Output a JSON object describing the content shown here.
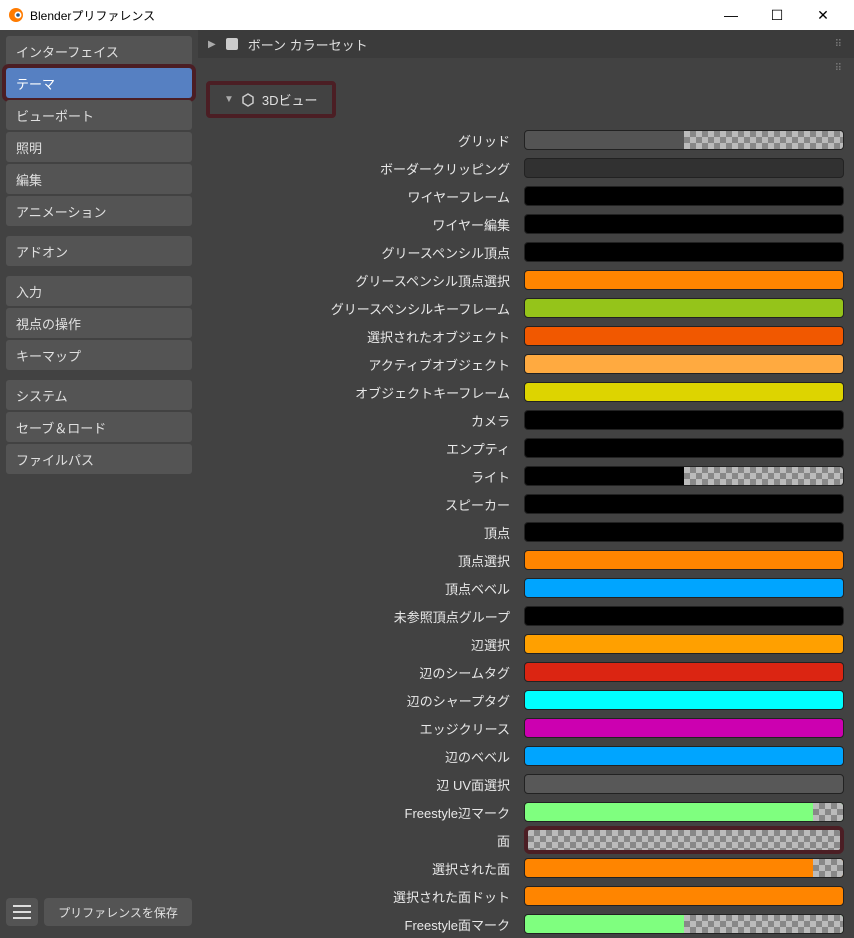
{
  "window": {
    "title": "Blenderプリファレンス"
  },
  "sidebar": {
    "groups": [
      {
        "items": [
          {
            "label": "インターフェイス",
            "selected": false
          },
          {
            "label": "テーマ",
            "selected": true,
            "highlighted": true
          },
          {
            "label": "ビューポート",
            "selected": false
          },
          {
            "label": "照明",
            "selected": false
          },
          {
            "label": "編集",
            "selected": false
          },
          {
            "label": "アニメーション",
            "selected": false
          }
        ]
      },
      {
        "items": [
          {
            "label": "アドオン",
            "selected": false
          }
        ]
      },
      {
        "items": [
          {
            "label": "入力",
            "selected": false
          },
          {
            "label": "視点の操作",
            "selected": false
          },
          {
            "label": "キーマップ",
            "selected": false
          }
        ]
      },
      {
        "items": [
          {
            "label": "システム",
            "selected": false
          },
          {
            "label": "セーブ＆ロード",
            "selected": false
          },
          {
            "label": "ファイルパス",
            "selected": false
          }
        ]
      }
    ],
    "save_label": "プリファレンスを保存"
  },
  "panel1": {
    "title": "ボーン カラーセット",
    "collapsed": true
  },
  "panel2": {
    "title": "3Dビュー",
    "highlighted": true
  },
  "color_items": [
    {
      "label": "グリッド",
      "color": "#545454",
      "alpha": true
    },
    {
      "label": "ボーダークリッピング",
      "color": "#313131"
    },
    {
      "label": "ワイヤーフレーム",
      "color": "#000000"
    },
    {
      "label": "ワイヤー編集",
      "color": "#000000"
    },
    {
      "label": "グリースペンシル頂点",
      "color": "#000000"
    },
    {
      "label": "グリースペンシル頂点選択",
      "color": "#ff8500"
    },
    {
      "label": "グリースペンシルキーフレーム",
      "color": "#95c41a"
    },
    {
      "label": "選択されたオブジェクト",
      "color": "#f15800"
    },
    {
      "label": "アクティブオブジェクト",
      "color": "#ffaa40"
    },
    {
      "label": "オブジェクトキーフレーム",
      "color": "#ddd400"
    },
    {
      "label": "カメラ",
      "color": "#000000"
    },
    {
      "label": "エンプティ",
      "color": "#000000"
    },
    {
      "label": "ライト",
      "color": "#000000",
      "alpha": true
    },
    {
      "label": "スピーカー",
      "color": "#000000"
    },
    {
      "label": "頂点",
      "color": "#000000"
    },
    {
      "label": "頂点選択",
      "color": "#ff8500"
    },
    {
      "label": "頂点ベベル",
      "color": "#00a5ff"
    },
    {
      "label": "未参照頂点グループ",
      "color": "#000000"
    },
    {
      "label": "辺選択",
      "color": "#ffa000"
    },
    {
      "label": "辺のシームタグ",
      "color": "#db2512"
    },
    {
      "label": "辺のシャープタグ",
      "color": "#00ffff"
    },
    {
      "label": "エッジクリース",
      "color": "#cc00b0"
    },
    {
      "label": "辺のベベル",
      "color": "#00a5ff"
    },
    {
      "label": "辺 UV面選択",
      "color": "#585858"
    },
    {
      "label": "Freestyle辺マーク",
      "color": "#7fff7f",
      "alpha_small": true
    },
    {
      "label": "面",
      "color": "#ffffff",
      "alpha_full": true,
      "highlighted": true
    },
    {
      "label": "選択された面",
      "color": "#ff8500",
      "alpha_small": true
    },
    {
      "label": "選択された面ドット",
      "color": "#ff8500"
    },
    {
      "label": "Freestyle面マーク",
      "color": "#7fff7f",
      "alpha": true
    }
  ]
}
